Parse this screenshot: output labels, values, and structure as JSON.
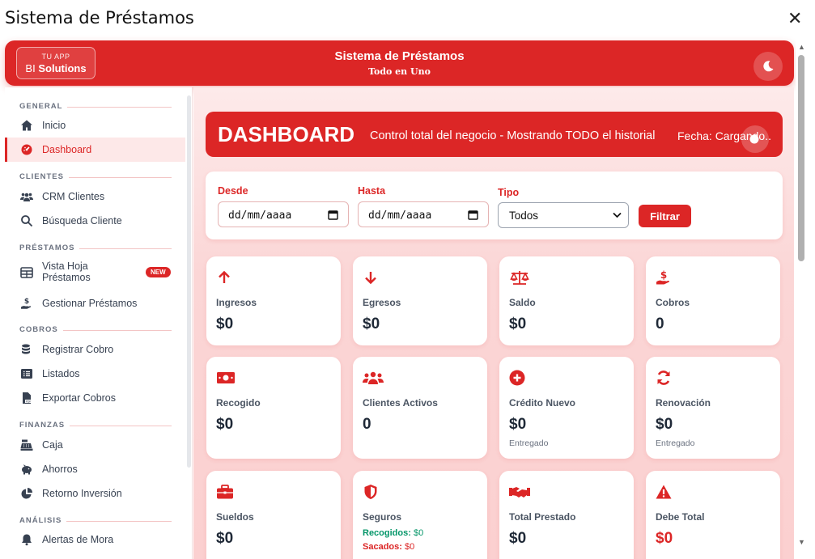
{
  "window": {
    "title": "Sistema de Préstamos",
    "close": "✕"
  },
  "header": {
    "logo_top": "TU APP",
    "logo_brand": "BI",
    "logo_name": "Solutions",
    "title": "Sistema de Préstamos",
    "subtitle": "Todo en Uno"
  },
  "sidebar": {
    "general": "GENERAL",
    "inicio": "Inicio",
    "dashboard": "Dashboard",
    "clientes": "CLIENTES",
    "crm": "CRM Clientes",
    "busqueda": "Búsqueda Cliente",
    "prestamos": "PRÉSTAMOS",
    "vista_l1": "Vista Hoja",
    "vista_l2": "Préstamos",
    "new_badge": "NEW",
    "gestionar": "Gestionar Préstamos",
    "cobros": "COBROS",
    "registrar": "Registrar Cobro",
    "listados": "Listados",
    "exportar": "Exportar Cobros",
    "finanzas": "FINANZAS",
    "caja": "Caja",
    "ahorros": "Ahorros",
    "retorno": "Retorno Inversión",
    "analisis": "ANÁLISIS",
    "alertas": "Alertas de Mora"
  },
  "dashboard": {
    "title": "DASHBOARD",
    "subtitle": "Control total del negocio - Mostrando TODO el historial",
    "fecha": "Fecha: Cargando..."
  },
  "filters": {
    "desde_label": "Desde",
    "desde_value": "dd/mm/aaaa",
    "hasta_label": "Hasta",
    "hasta_value": "dd/mm/aaaa",
    "tipo_label": "Tipo",
    "tipo_value": "Todos",
    "button": "Filtrar"
  },
  "cards": {
    "ingresos": {
      "label": "Ingresos",
      "value": "$0"
    },
    "egresos": {
      "label": "Egresos",
      "value": "$0"
    },
    "saldo": {
      "label": "Saldo",
      "value": "$0"
    },
    "cobros": {
      "label": "Cobros",
      "value": "0"
    },
    "recogido": {
      "label": "Recogido",
      "value": "$0"
    },
    "clientes": {
      "label": "Clientes Activos",
      "value": "0"
    },
    "credito": {
      "label": "Crédito Nuevo",
      "value": "$0",
      "sub": "Entregado"
    },
    "renovacion": {
      "label": "Renovación",
      "value": "$0",
      "sub": "Entregado"
    },
    "sueldos": {
      "label": "Sueldos",
      "value": "$0"
    },
    "seguros": {
      "label": "Seguros",
      "rec_label": "Recogidos:",
      "rec_value": "$0",
      "sac_label": "Sacados:",
      "sac_value": "$0"
    },
    "prestado": {
      "label": "Total Prestado",
      "value": "$0"
    },
    "debe": {
      "label": "Debe Total",
      "value": "$0"
    }
  },
  "colors": {
    "accent": "#dc2626",
    "success": "#059669"
  }
}
